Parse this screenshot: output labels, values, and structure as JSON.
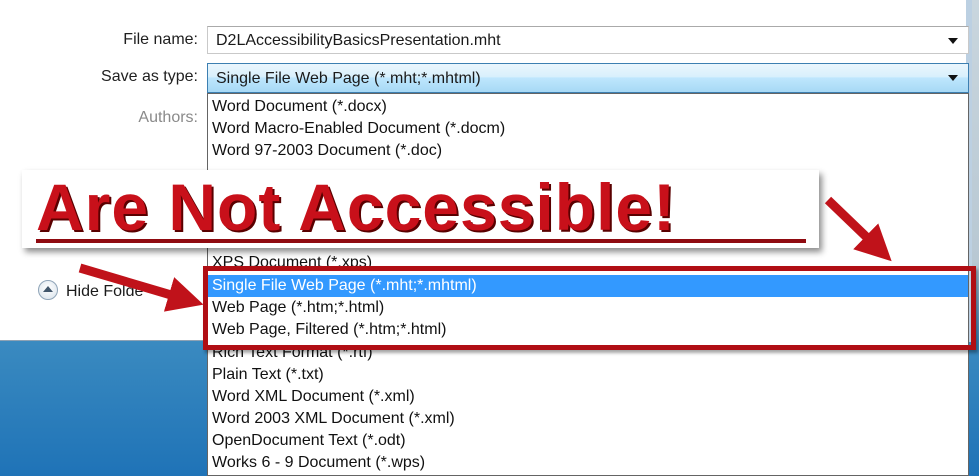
{
  "dialog": {
    "file_name_label": "File name:",
    "file_name_value": "D2LAccessibilityBasicsPresentation.mht",
    "save_as_type_label": "Save as type:",
    "save_as_type_value": "Single File Web Page (*.mht;*.mhtml)",
    "authors_label": "Authors:",
    "hide_folders_label": "Hide Folde"
  },
  "dropdown": {
    "options": [
      "Word Document (*.docx)",
      "Word Macro-Enabled Document (*.docm)",
      "Word 97-2003 Document (*.doc)",
      "XPS Document (*.xps)",
      "Single File Web Page (*.mht;*.mhtml)",
      "Web Page (*.htm;*.html)",
      "Web Page, Filtered (*.htm;*.html)",
      "Rich Text Format (*.rtf)",
      "Plain Text (*.txt)",
      "Word XML Document (*.xml)",
      "Word 2003 XML Document (*.xml)",
      "OpenDocument Text (*.odt)",
      "Works 6 - 9 Document (*.wps)"
    ],
    "selected": "Single File Web Page (*.mht;*.mhtml)"
  },
  "annotation": {
    "banner_text": "Are Not Accessible!",
    "color": "#c8101a"
  },
  "colors": {
    "selection": "#3399ff",
    "highlight_border": "#b00e14"
  }
}
